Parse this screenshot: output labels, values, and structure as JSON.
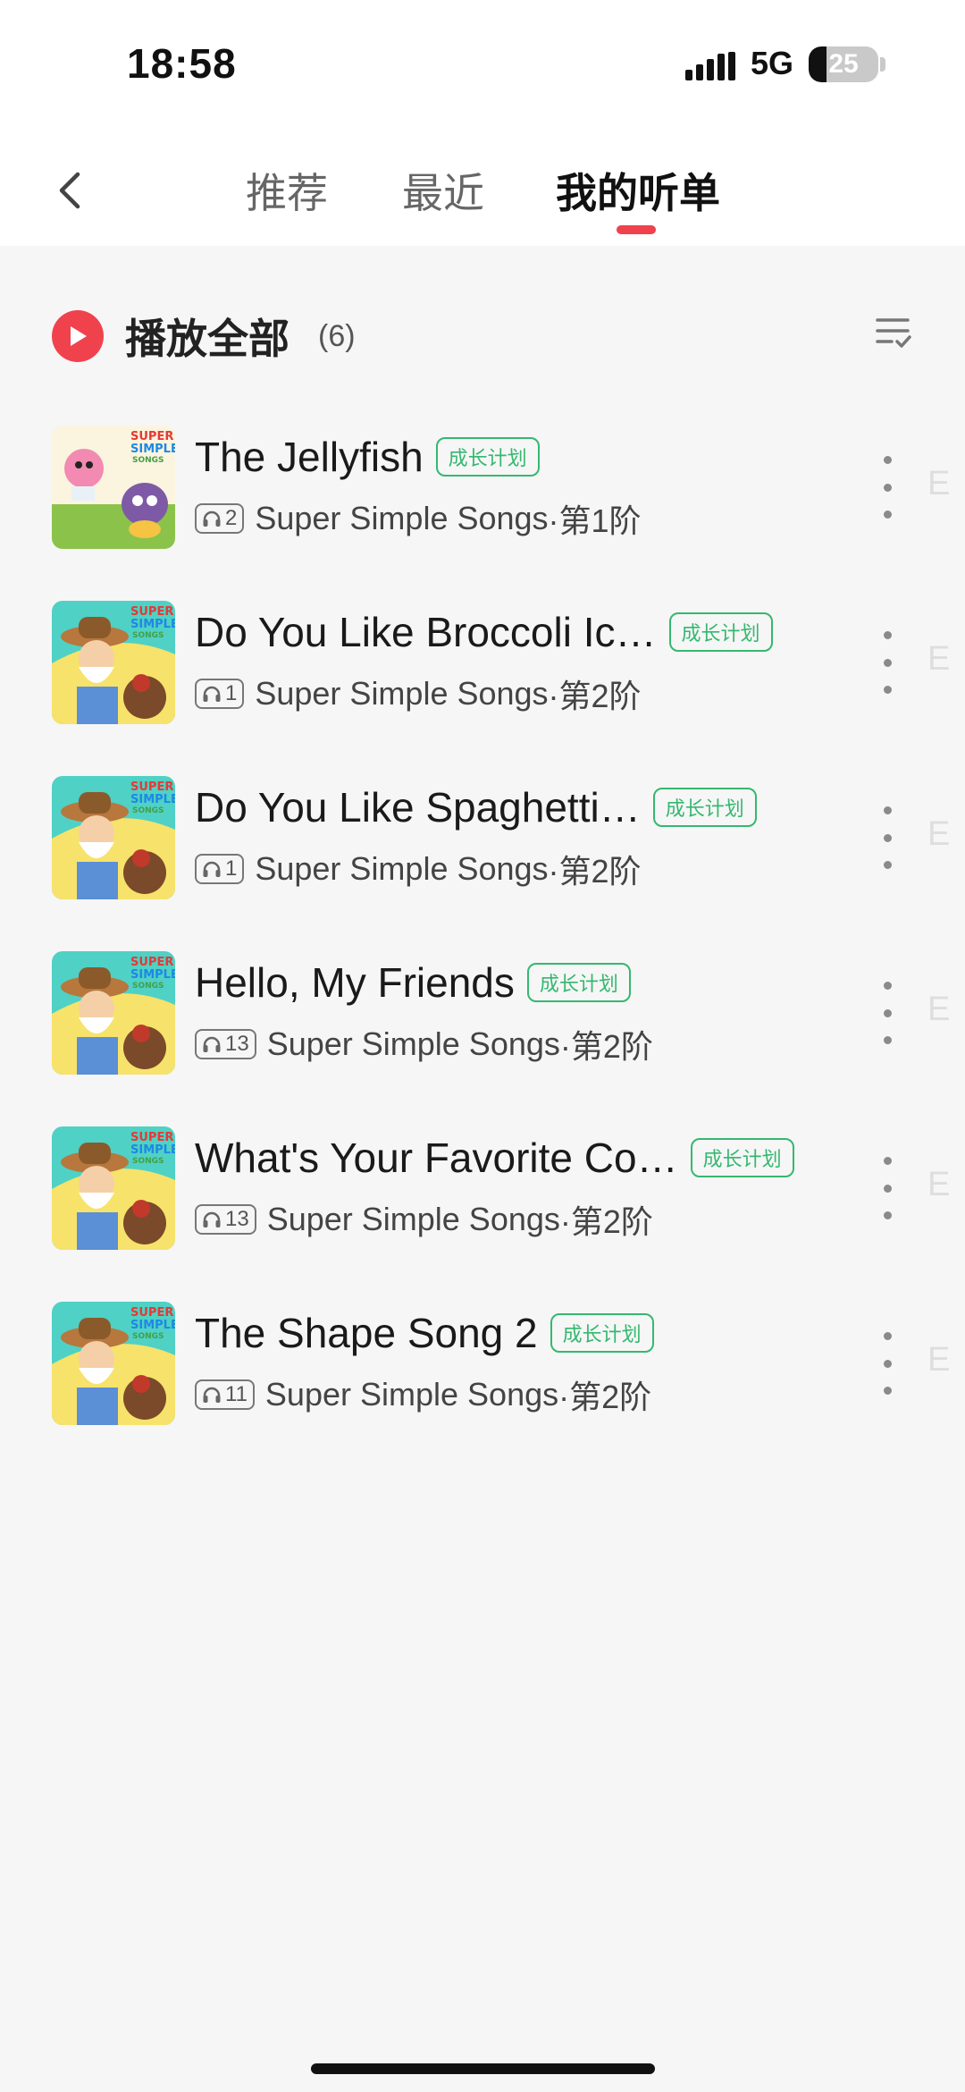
{
  "status": {
    "time": "18:58",
    "network": "5G",
    "battery": "25",
    "battery_level": 0.25
  },
  "header": {
    "back_icon": "chevron-left-icon",
    "tabs": [
      {
        "label": "推荐",
        "active": false
      },
      {
        "label": "最近",
        "active": false
      },
      {
        "label": "我的听单",
        "active": true
      }
    ],
    "accent": "#f0424d"
  },
  "play_all": {
    "label": "播放全部",
    "count": "(6)",
    "icon": "play-circle-icon",
    "sort_icon": "sort-list-icon"
  },
  "tag_color": "#35b870",
  "items": [
    {
      "title": "The Jellyfish",
      "tag": "成长计划",
      "plays": "2",
      "source": "Super Simple Songs",
      "level": "·第1阶",
      "edge": "E"
    },
    {
      "title": "Do You Like Broccoli Ic…",
      "tag": "成长计划",
      "plays": "1",
      "source": "Super Simple Songs",
      "level": "·第2阶",
      "edge": "E"
    },
    {
      "title": "Do You Like Spaghetti…",
      "tag": "成长计划",
      "plays": "1",
      "source": "Super Simple Songs",
      "level": "·第2阶",
      "edge": "E"
    },
    {
      "title": "Hello, My Friends",
      "tag": "成长计划",
      "plays": "13",
      "source": "Super Simple Songs",
      "level": "·第2阶",
      "edge": "E"
    },
    {
      "title": "What's Your Favorite Co…",
      "tag": "成长计划",
      "plays": "13",
      "source": "Super Simple Songs",
      "level": "·第2阶",
      "edge": "E"
    },
    {
      "title": "The Shape Song 2",
      "tag": "成长计划",
      "plays": "11",
      "source": "Super Simple Songs",
      "level": "·第2阶",
      "edge": "E"
    }
  ],
  "thumb_logo": {
    "line1": "SUPER",
    "line2": "SIMPLE",
    "line3": "SONGS"
  }
}
